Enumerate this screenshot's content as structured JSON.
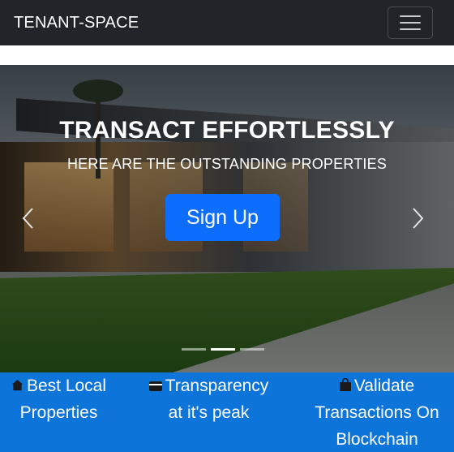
{
  "navbar": {
    "brand": "TENANT-SPACE",
    "toggler_icon": "hamburger-menu-icon"
  },
  "hero": {
    "title": "TRANSACT EFFORTLESSLY",
    "subtitle": "HERE ARE THE OUTSTANDING PROPERTIES",
    "cta_label": "Sign Up",
    "slide_count": 3,
    "active_slide": 2
  },
  "features": [
    {
      "icon": "house-icon",
      "line1": "Best Local",
      "line2": "Properties",
      "line3": ""
    },
    {
      "icon": "credit-card-icon",
      "line1": "Transparency",
      "line2": "at it's peak",
      "line3": ""
    },
    {
      "icon": "shopping-bag-icon",
      "line1": "Validate",
      "line2": "Transactions On",
      "line3": "Blockchain"
    }
  ],
  "colors": {
    "navbar_bg": "#212529",
    "cta_bg": "#0d6efd",
    "features_bg": "#0d74d9"
  }
}
